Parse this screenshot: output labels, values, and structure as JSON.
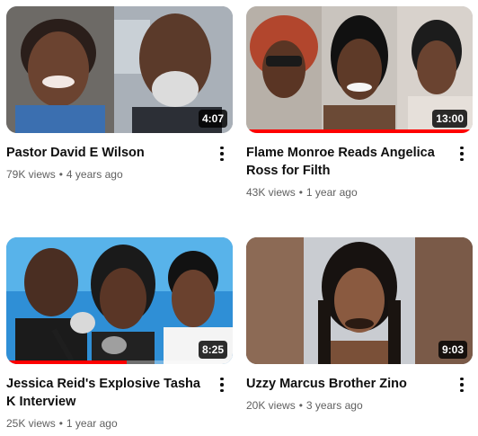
{
  "videos": [
    {
      "title": "Pastor David E Wilson",
      "views": "79K views",
      "age": "4 years ago",
      "duration": "4:07",
      "watched_fraction": 0
    },
    {
      "title": "Flame Monroe Reads Angelica Ross for Filth",
      "views": "43K views",
      "age": "1 year ago",
      "duration": "13:00",
      "watched_fraction": 1.0
    },
    {
      "title": "Jessica Reid's Explosive Tasha K Interview",
      "views": "25K views",
      "age": "1 year ago",
      "duration": "8:25",
      "watched_fraction": 0.53
    },
    {
      "title": "Uzzy Marcus Brother Zino",
      "views": "20K views",
      "age": "3 years ago",
      "duration": "9:03",
      "watched_fraction": 0
    }
  ],
  "icons": {
    "more": "three-dots-vertical-icon"
  },
  "colors": {
    "progress": "#ff0000",
    "meta_text": "#606060",
    "title_text": "#0f0f0f"
  }
}
